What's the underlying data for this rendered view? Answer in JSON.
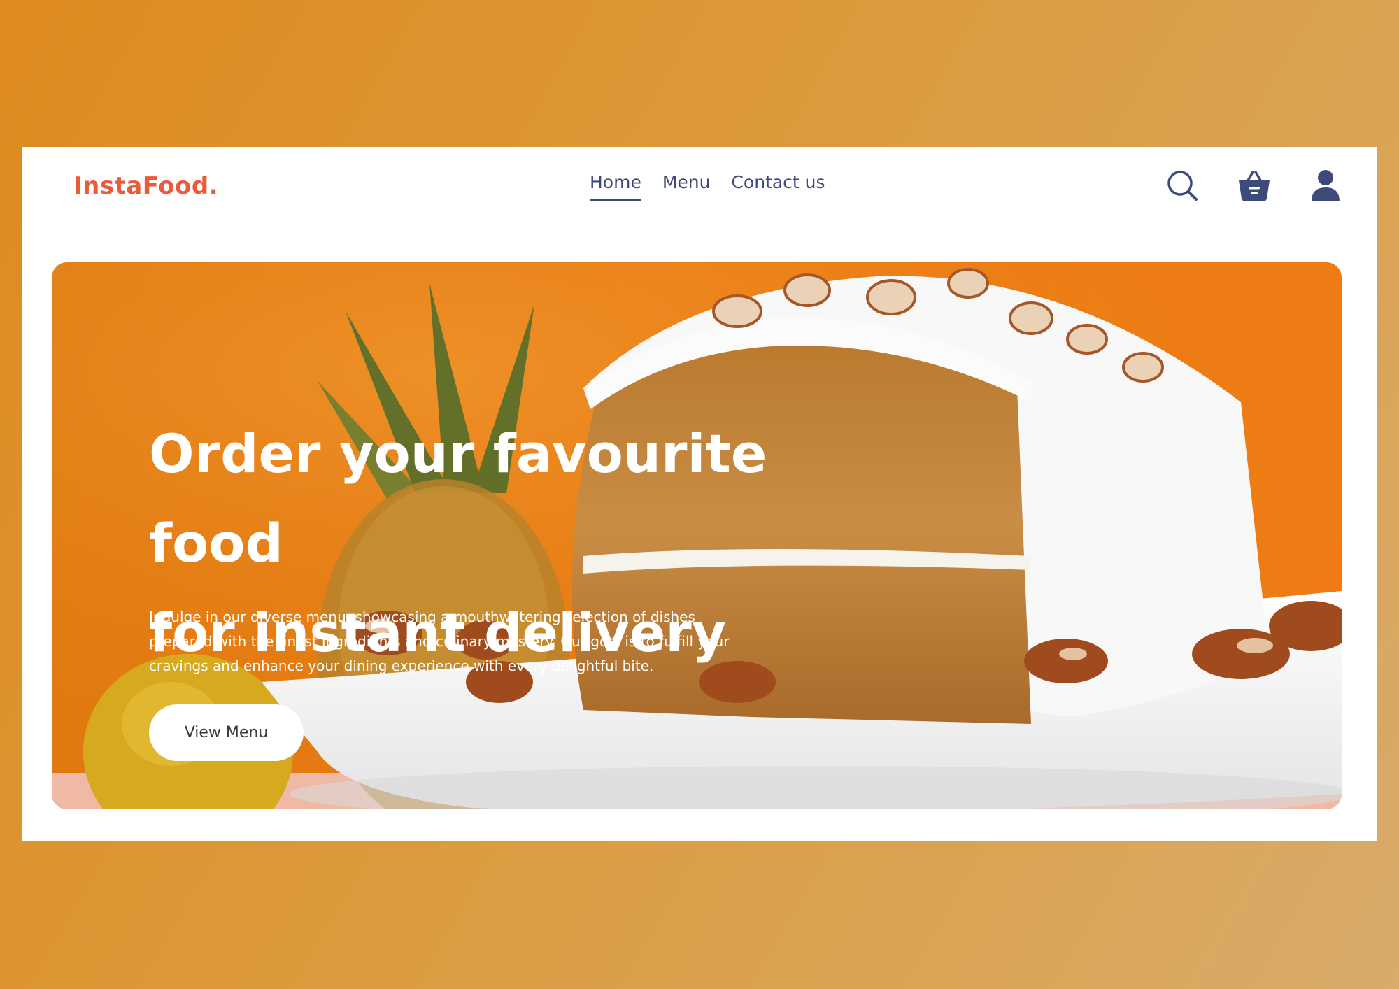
{
  "brand": {
    "logo_text": "InstaFood.",
    "color": "#ec5a3c"
  },
  "nav": {
    "items": [
      {
        "label": "Home",
        "active": true
      },
      {
        "label": "Menu",
        "active": false
      },
      {
        "label": "Contact us",
        "active": false
      }
    ],
    "color": "#3d4a7a"
  },
  "header_icons": [
    {
      "name": "search-icon"
    },
    {
      "name": "basket-icon"
    },
    {
      "name": "user-icon"
    }
  ],
  "hero": {
    "title_line1": "Order your favourite food",
    "title_line2": "for instant delivery",
    "description": "Indulge in our diverse menu, showcasing a mouthwatering selection of dishes prepared with the finest ingredients and culinary mastery. Our goal is to fulfill your cravings and enhance your dining experience with every delightful bite.",
    "cta_label": "View Menu",
    "image_subject": "frosted cake slice with nuts, pineapple and orange background"
  }
}
